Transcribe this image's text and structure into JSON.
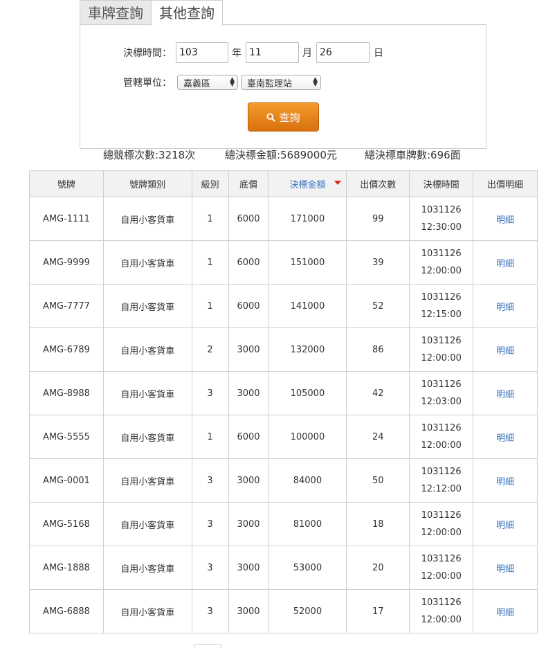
{
  "tabs": [
    {
      "label": "車牌查詢"
    },
    {
      "label": "其他查詢"
    }
  ],
  "form": {
    "date_label": "決標時間：",
    "year_value": "103",
    "year_unit": "年",
    "month_value": "11",
    "month_unit": "月",
    "day_value": "26",
    "day_unit": "日",
    "unit_label": "管轄單位：",
    "district_value": "嘉義區",
    "station_value": "臺南監理站",
    "query_label": "查詢"
  },
  "stats": {
    "total_bids": "總競標次數:3218次",
    "total_amount": "總決標金額:5689000元",
    "total_plates": "總決標車牌數:696面"
  },
  "table": {
    "headers": [
      "號牌",
      "號牌類別",
      "級別",
      "底價",
      "決標金額",
      "出價次數",
      "決標時間",
      "出價明細"
    ],
    "sorted_column": "決標金額",
    "rows": [
      {
        "plate": "AMG-1111",
        "type": "自用小客貨車",
        "level": "1",
        "base": "6000",
        "amount": "171000",
        "bids": "99",
        "date": "1031126",
        "time": "12:30:00",
        "detail": "明細"
      },
      {
        "plate": "AMG-9999",
        "type": "自用小客貨車",
        "level": "1",
        "base": "6000",
        "amount": "151000",
        "bids": "39",
        "date": "1031126",
        "time": "12:00:00",
        "detail": "明細"
      },
      {
        "plate": "AMG-7777",
        "type": "自用小客貨車",
        "level": "1",
        "base": "6000",
        "amount": "141000",
        "bids": "52",
        "date": "1031126",
        "time": "12:15:00",
        "detail": "明細"
      },
      {
        "plate": "AMG-6789",
        "type": "自用小客貨車",
        "level": "2",
        "base": "3000",
        "amount": "132000",
        "bids": "86",
        "date": "1031126",
        "time": "12:00:00",
        "detail": "明細"
      },
      {
        "plate": "AMG-8988",
        "type": "自用小客貨車",
        "level": "3",
        "base": "3000",
        "amount": "105000",
        "bids": "42",
        "date": "1031126",
        "time": "12:03:00",
        "detail": "明細"
      },
      {
        "plate": "AMG-5555",
        "type": "自用小客貨車",
        "level": "1",
        "base": "6000",
        "amount": "100000",
        "bids": "24",
        "date": "1031126",
        "time": "12:00:00",
        "detail": "明細"
      },
      {
        "plate": "AMG-0001",
        "type": "自用小客貨車",
        "level": "3",
        "base": "3000",
        "amount": "84000",
        "bids": "50",
        "date": "1031126",
        "time": "12:12:00",
        "detail": "明細"
      },
      {
        "plate": "AMG-5168",
        "type": "自用小客貨車",
        "level": "3",
        "base": "3000",
        "amount": "81000",
        "bids": "18",
        "date": "1031126",
        "time": "12:00:00",
        "detail": "明細"
      },
      {
        "plate": "AMG-1888",
        "type": "自用小客貨車",
        "level": "3",
        "base": "3000",
        "amount": "53000",
        "bids": "20",
        "date": "1031126",
        "time": "12:00:00",
        "detail": "明細"
      },
      {
        "plate": "AMG-6888",
        "type": "自用小客貨車",
        "level": "3",
        "base": "3000",
        "amount": "52000",
        "bids": "17",
        "date": "1031126",
        "time": "12:00:00",
        "detail": "明細"
      }
    ]
  },
  "colors": {
    "accent_orange": "#e8861f",
    "link_blue": "#3a76c4",
    "sort_indicator_red": "#d9251c"
  }
}
